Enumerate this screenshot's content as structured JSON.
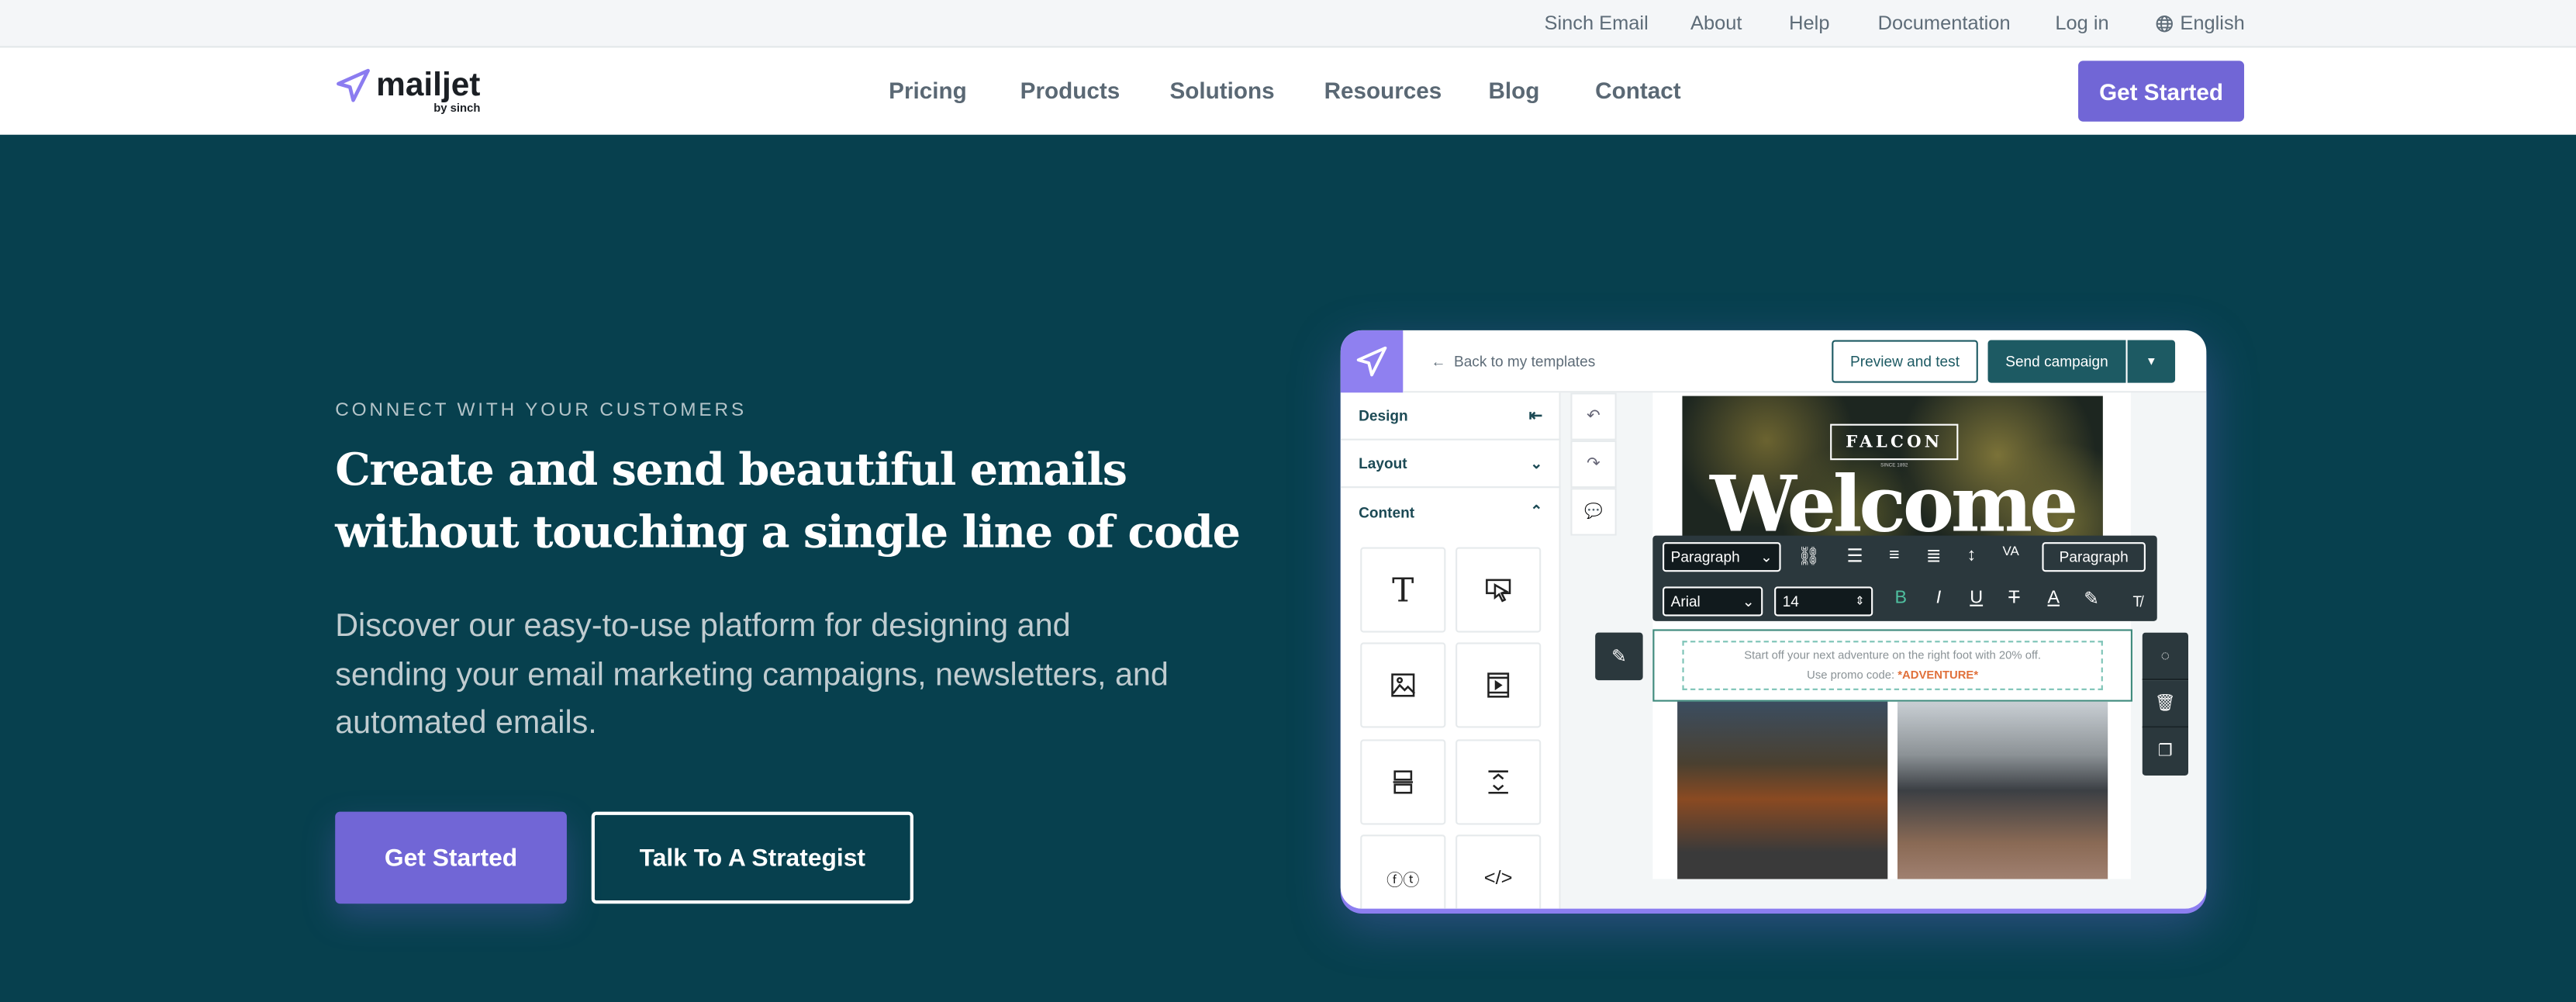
{
  "topbar": {
    "links": [
      "Sinch Email",
      "About",
      "Help",
      "Documentation",
      "Log in"
    ],
    "language": "English",
    "language_icon": "globe-icon"
  },
  "nav": {
    "logo": "mailjet",
    "logo_sub": "by sinch",
    "items": [
      "Pricing",
      "Products",
      "Solutions",
      "Resources",
      "Blog",
      "Contact"
    ],
    "cta": "Get Started"
  },
  "hero": {
    "eyebrow": "CONNECT WITH YOUR CUSTOMERS",
    "title_line1": "Create and send beautiful emails",
    "title_line2": "without touching a single line of code",
    "lead": "Discover our easy-to-use platform for designing and sending your email marketing campaigns, newsletters, and automated emails.",
    "primary": "Get Started",
    "secondary": "Talk To A Strategist"
  },
  "editor": {
    "back": "Back to my templates",
    "preview": "Preview and test",
    "send": "Send campaign",
    "sidebar": {
      "design": "Design",
      "layout": "Layout",
      "content": "Content"
    },
    "tiles": [
      "text-icon",
      "button-icon",
      "image-icon",
      "video-icon",
      "divider-icon",
      "spacer-icon",
      "social-icon",
      "html-icon"
    ],
    "email": {
      "brand": "FALCON",
      "brand_sub": "SINCE 1892",
      "headline": "Welcome",
      "body": "Start off your next adventure on the right foot with 20% off.",
      "promo_label": "Use promo code:",
      "promo_code": "*ADVENTURE*"
    },
    "toolbar": {
      "block_type": "Paragraph",
      "style": "Paragraph",
      "font": "Arial",
      "size": "14"
    }
  },
  "colors": {
    "brand_purple": "#7166d6",
    "hero_bg": "#07404e",
    "editor_teal": "#1d5a63",
    "promo": "#e0703a"
  }
}
